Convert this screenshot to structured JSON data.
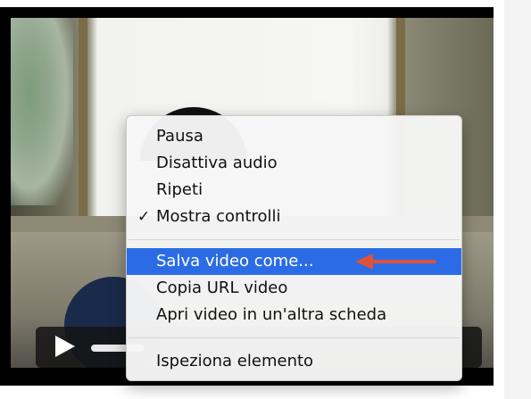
{
  "context_menu": {
    "items": [
      {
        "label": "Pausa",
        "checked": false
      },
      {
        "label": "Disattiva audio",
        "checked": false
      },
      {
        "label": "Ripeti",
        "checked": false
      },
      {
        "label": "Mostra controlli",
        "checked": true
      },
      {
        "label": "Salva video come...",
        "highlighted": true
      },
      {
        "label": "Copia URL video"
      },
      {
        "label": "Apri video in un'altra scheda"
      },
      {
        "label": "Ispeziona elemento"
      }
    ],
    "checkmark": "✓"
  },
  "colors": {
    "highlight": "#2b6ce6",
    "annotation_arrow": "#e0513a"
  }
}
